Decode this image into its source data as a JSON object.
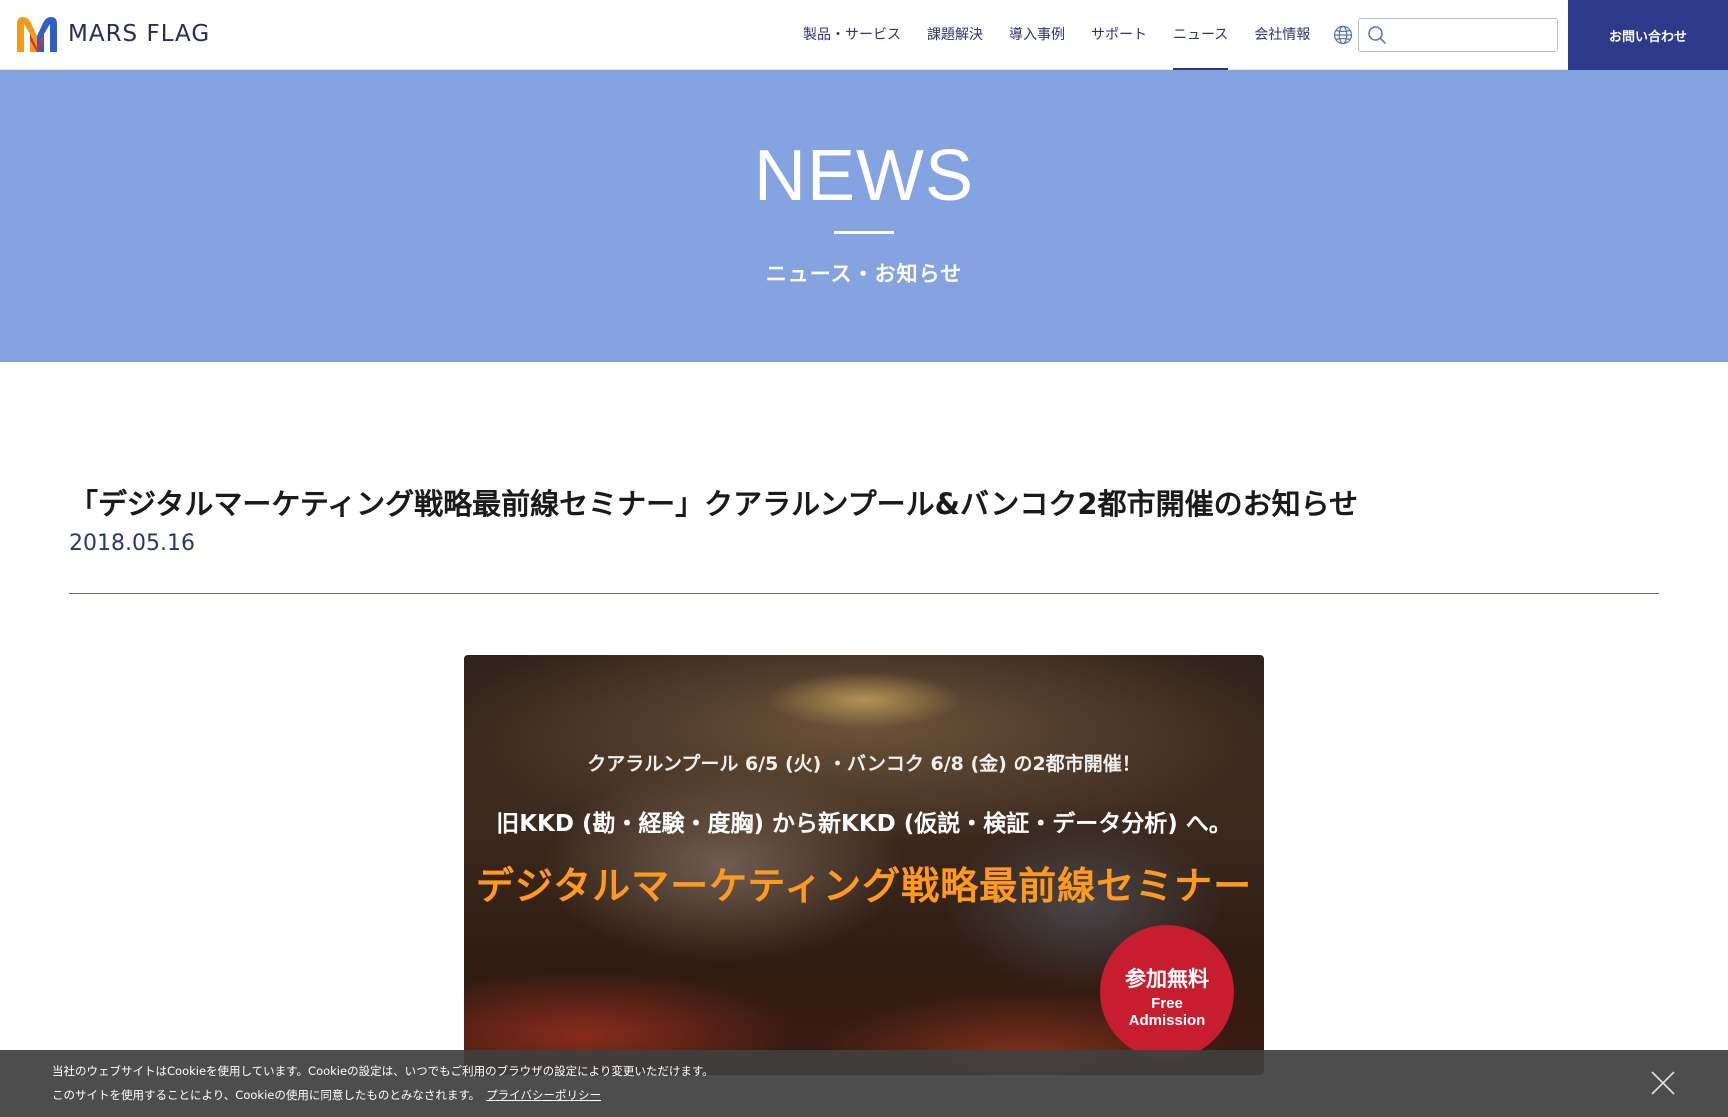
{
  "header": {
    "logo_text": "MARS FLAG",
    "nav": [
      {
        "label": "製品・サービス",
        "active": false
      },
      {
        "label": "課題解決",
        "active": false
      },
      {
        "label": "導入事例",
        "active": false
      },
      {
        "label": "サポート",
        "active": false
      },
      {
        "label": "ニュース",
        "active": true
      },
      {
        "label": "会社情報",
        "active": false
      }
    ],
    "search_placeholder": "",
    "contact_label": "お問い合わせ",
    "icons": {
      "language": "globe-icon",
      "search": "search-icon"
    }
  },
  "hero": {
    "title": "NEWS",
    "subtitle": "ニュース・お知らせ"
  },
  "article": {
    "title": "「デジタルマーケティング戦略最前線セミナー」クアラルンプール&バンコク2都市開催のお知らせ",
    "date": "2018.05.16"
  },
  "banner": {
    "line1": "クアラルンプール 6/5 (火) ・バンコク 6/8 (金) の2都市開催！",
    "line2": "旧KKD (勘・経験・度胸) から新KKD (仮説・検証・データ分析) へ。",
    "line3": "デジタルマーケティング戦略最前線セミナー",
    "badge_jp": "参加無料",
    "badge_en1": "Free",
    "badge_en2": "Admission"
  },
  "cookie": {
    "line1": "当社のウェブサイトはCookieを使用しています。Cookieの設定は、いつでもご利用のブラウザの設定により変更いただけます。",
    "line2": "このサイトを使用することにより、Cookieの使用に同意したものとみなされます。",
    "link": "プライバシーポリシー"
  },
  "colors": {
    "brand_navy": "#2d3573",
    "contact_bg": "#2d3a8c",
    "hero_bg": "#84a3e0",
    "banner_orange": "#ff9a1f",
    "badge_red": "#c81d2e",
    "logo_orange": "#f39a1e",
    "logo_blue": "#2f5fc4"
  }
}
